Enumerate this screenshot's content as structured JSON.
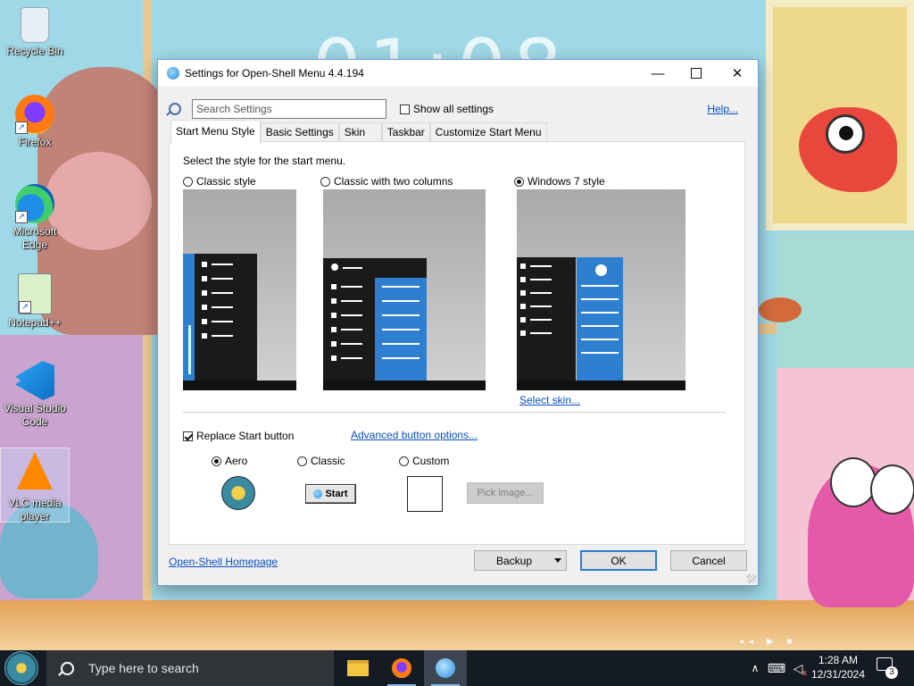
{
  "desktop": {
    "icons": [
      {
        "label": "Recycle Bin",
        "icon": "recycle-bin-icon"
      },
      {
        "label": "Firefox",
        "icon": "firefox-icon"
      },
      {
        "label": "Microsoft Edge",
        "icon": "edge-icon"
      },
      {
        "label": "Notepad++",
        "icon": "notepad-plus-plus-icon"
      },
      {
        "label": "Visual Studio Code",
        "icon": "vscode-icon"
      },
      {
        "label": "VLC media player",
        "icon": "vlc-icon"
      }
    ],
    "wallpaper_clock": "01:08"
  },
  "dialog": {
    "title": "Settings for Open-Shell Menu 4.4.194",
    "search_placeholder": "Search Settings",
    "show_all_label": "Show all settings",
    "show_all_checked": false,
    "help_link": "Help...",
    "tabs": [
      "Start Menu Style",
      "Basic Settings",
      "Skin",
      "Taskbar",
      "Customize Start Menu"
    ],
    "active_tab": "Start Menu Style",
    "prompt": "Select the style for the start menu.",
    "styles": [
      {
        "label": "Classic style",
        "selected": false
      },
      {
        "label": "Classic with two columns",
        "selected": false
      },
      {
        "label": "Windows 7 style",
        "selected": true
      }
    ],
    "select_skin_link": "Select skin...",
    "replace_start_label": "Replace Start button",
    "replace_start_checked": true,
    "advanced_link": "Advanced button options...",
    "button_styles": [
      {
        "label": "Aero",
        "selected": true
      },
      {
        "label": "Classic",
        "selected": false
      },
      {
        "label": "Custom",
        "selected": false
      }
    ],
    "classic_button_text": "Start",
    "pick_image_label": "Pick image...",
    "homepage_link": "Open-Shell Homepage",
    "backup_label": "Backup",
    "ok_label": "OK",
    "cancel_label": "Cancel",
    "accent_color": "#2f78d4"
  },
  "taskbar": {
    "search_placeholder": "Type here to search",
    "apps": [
      {
        "name": "File Explorer",
        "icon": "folder-icon"
      },
      {
        "name": "Firefox",
        "icon": "firefox-icon"
      },
      {
        "name": "Open-Shell Settings",
        "icon": "open-shell-icon",
        "active": true
      }
    ],
    "time": "1:28 AM",
    "date": "12/31/2024",
    "notification_count": "3"
  }
}
